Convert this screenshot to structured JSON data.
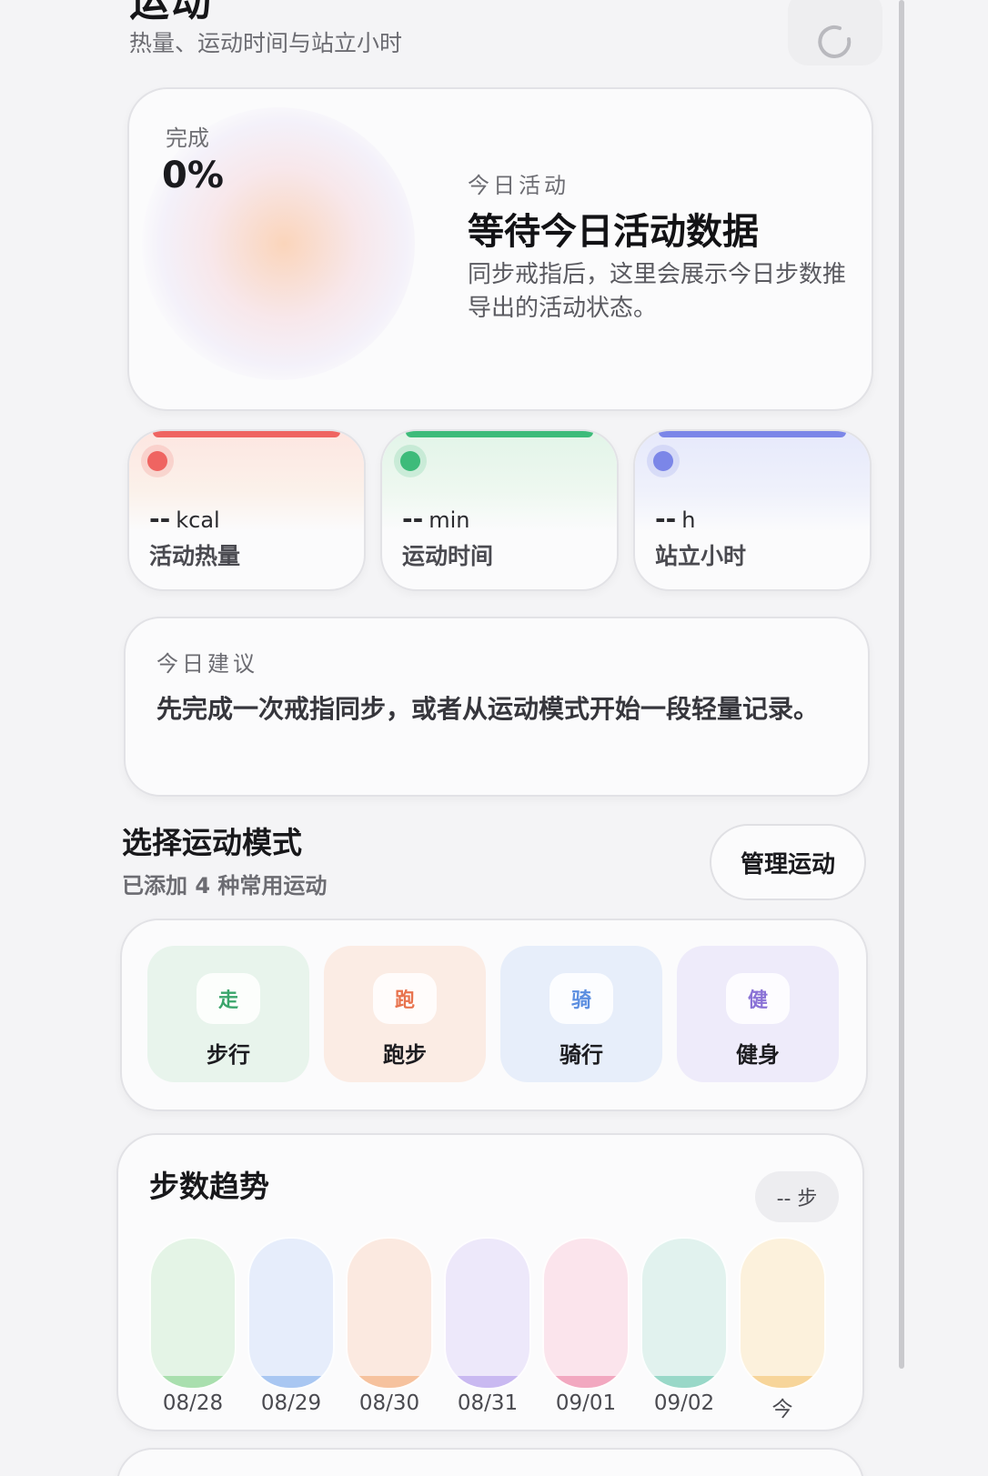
{
  "header": {
    "title": "运动",
    "subtitle": "热量、运动时间与站立小时",
    "refresh_icon": "refresh-icon"
  },
  "hero": {
    "completion_label": "完成",
    "completion_value": "0%",
    "eyebrow": "今日活动",
    "title": "等待今日活动数据",
    "description": "同步戒指后，这里会展示今日步数推导出的活动状态。"
  },
  "metrics": [
    {
      "value": "--",
      "unit": "kcal",
      "label": "活动热量",
      "color": "#ef6461"
    },
    {
      "value": "--",
      "unit": "min",
      "label": "运动时间",
      "color": "#3dbb7a"
    },
    {
      "value": "--",
      "unit": "h",
      "label": "站立小时",
      "color": "#7b86e8"
    }
  ],
  "suggestion": {
    "eyebrow": "今日建议",
    "text": "先完成一次戒指同步，或者从运动模式开始一段轻量记录。"
  },
  "modes": {
    "title": "选择运动模式",
    "subtitle": "已添加 4 种常用运动",
    "manage_label": "管理运动",
    "items": [
      {
        "icon_text": "走",
        "label": "步行",
        "color": "#3aa56b",
        "bg": "#e8f4ec"
      },
      {
        "icon_text": "跑",
        "label": "跑步",
        "color": "#e8734e",
        "bg": "#fbece4"
      },
      {
        "icon_text": "骑",
        "label": "骑行",
        "color": "#5b8ee0",
        "bg": "#e7eefa"
      },
      {
        "icon_text": "健",
        "label": "健身",
        "color": "#8a72d6",
        "bg": "#eeebfa"
      }
    ]
  },
  "trend": {
    "title": "步数趋势",
    "pill": "-- 步",
    "days": [
      {
        "label": "08/28",
        "bg": "#e4f4e6",
        "fill": "#a9dfae",
        "level": 0.08
      },
      {
        "label": "08/29",
        "bg": "#e6edfb",
        "fill": "#a9c7f2",
        "level": 0.08
      },
      {
        "label": "08/30",
        "bg": "#fbe9e0",
        "fill": "#f6c29e",
        "level": 0.08
      },
      {
        "label": "08/31",
        "bg": "#ede8fa",
        "fill": "#c9b9f1",
        "level": 0.08
      },
      {
        "label": "09/01",
        "bg": "#fbe4ec",
        "fill": "#f2a8c0",
        "level": 0.08
      },
      {
        "label": "09/02",
        "bg": "#e1f2ee",
        "fill": "#99d8c8",
        "level": 0.08
      },
      {
        "label": "今",
        "bg": "#fcf1dc",
        "fill": "#f7d59a",
        "level": 0.08
      }
    ]
  }
}
